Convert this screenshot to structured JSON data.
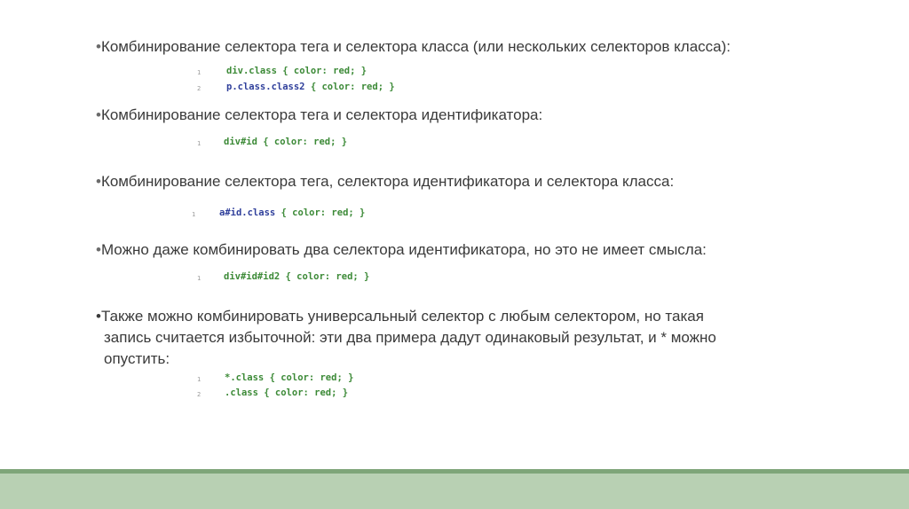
{
  "bullets": {
    "b1": "Комбинирование селектора тега и селектора класса (или нескольких селекторов класса):",
    "b2": "Комбинирование селектора тега и селектора идентификатора:",
    "b3": "Комбинирование селектора тега, селектора идентификатора и селектора класса:",
    "b4": "Можно даже комбинировать два селектора идентификатора, но это не имеет смысла:",
    "b5_line1": "Также можно комбинировать универсальный селектор с любым селектором, но такая",
    "b5_line2": "запись считается избыточной: эти два примера дадут одинаковый результат, и * можно",
    "b5_line3": "опустить:"
  },
  "bullet_char": "•",
  "code": {
    "ex1": [
      {
        "num": "1",
        "sel": "div.class",
        "rest": " { color: red; }"
      },
      {
        "num": "2",
        "sel": "p.class.class2",
        "rest": " { color: red; }"
      }
    ],
    "ex2": [
      {
        "num": "1",
        "sel": "div#id",
        "rest": " { color: red; }"
      }
    ],
    "ex3": [
      {
        "num": "1",
        "sel": "a#id.class",
        "rest": " { color: red; }"
      }
    ],
    "ex4": [
      {
        "num": "1",
        "sel": "div#id#id2",
        "rest": " { color: red; }"
      }
    ],
    "ex5": [
      {
        "num": "1",
        "sel": "*.class",
        "rest": " { color: red; }"
      },
      {
        "num": "2",
        "sel": ".class",
        "rest": " { color: red; }"
      }
    ]
  },
  "colors": {
    "selector_blue": "#2f3f9b",
    "code_green": "#3c8a37",
    "footer_line": "#7ea579",
    "footer_bar": "#b8d0b3"
  }
}
